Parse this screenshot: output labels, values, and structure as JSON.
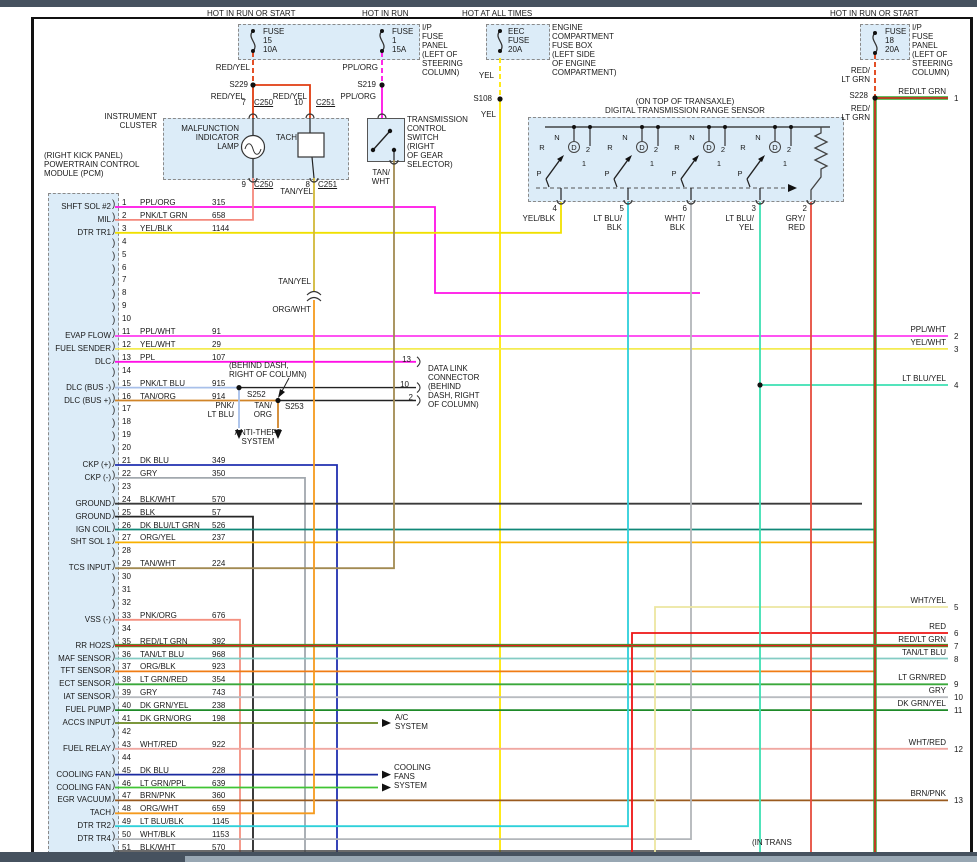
{
  "window": {
    "top_bar_color": "#46525f",
    "bottom_bar_color": "#46525f",
    "scroll_thumb_color": "#98a7b3",
    "page_bg": "#ffffff"
  },
  "labels": {
    "hot_left": "HOT IN RUN OR START",
    "hot_mid": "HOT IN RUN",
    "hot_eec": "HOT AT ALL TIMES",
    "hot_right": "HOT IN RUN OR START",
    "fuse15_1": "FUSE",
    "fuse15_2": "15",
    "fuse15_3": "10A",
    "fuse1_1": "FUSE",
    "fuse1_2": "1",
    "fuse1_3": "15A",
    "eec_1": "EEC",
    "eec_2": "FUSE",
    "eec_3": "20A",
    "fuse18_1": "FUSE",
    "fuse18_2": "18",
    "fuse18_3": "20A",
    "ip_note": [
      "I/P",
      "FUSE",
      "PANEL",
      "(LEFT OF",
      "STEERING",
      "COLUMN)"
    ],
    "eec_note": [
      "ENGINE",
      "COMPARTMENT",
      "FUSE BOX",
      "(LEFT SIDE",
      "OF ENGINE",
      "COMPARTMENT)"
    ],
    "ip_note_r": [
      "I/P",
      "FUSE",
      "PANEL",
      "(LEFT OF",
      "STEERING",
      "COLUMN)"
    ],
    "red_yel_a": "RED/YEL",
    "red_yel_b": "RED/YEL",
    "red_yel_c": "RED/YEL",
    "s229": "S229",
    "s219": "S219",
    "s108": "S108",
    "s228": "S228",
    "s252": "S252",
    "s253": "S253",
    "ppl_org_a": "PPL/ORG",
    "ppl_org_b": "PPL/ORG",
    "yel_a": "YEL",
    "yel_b": "YEL",
    "red_lt_a": [
      "RED/",
      "LT GRN"
    ],
    "red_lt_b": [
      "RED/",
      "LT GRN"
    ],
    "cluster_title": [
      "INSTRUMENT",
      "CLUSTER"
    ],
    "mil": [
      "MALFUNCTION",
      "INDICATOR",
      "LAMP"
    ],
    "tach": "TACH",
    "c250t_pin": "7",
    "c250t": "C250",
    "c251t_pin": "10",
    "c251t": "C251",
    "c250b_pin": "9",
    "c250b": "C250",
    "c251b_pin": "8",
    "c251b": "C251",
    "tan_yel_a": "TAN/YEL",
    "tan_yel_b": "TAN/YEL",
    "org_wht": "ORG/WHT",
    "tcs_note": [
      "TRANSMISSION",
      "CONTROL",
      "SWITCH",
      "(RIGHT",
      "OF GEAR",
      "SELECTOR)"
    ],
    "tan_wht": [
      "TAN/",
      "WHT"
    ],
    "dtr_loc": "(ON TOP OF TRANSAXLE)",
    "dtr_title": "DIGITAL TRANSMISSION RANGE SENSOR",
    "behind_dash": [
      "(BEHIND DASH,",
      "RIGHT OF COLUMN)"
    ],
    "dlc_note": [
      "DATA LINK",
      "CONNECTOR",
      "(BEHIND",
      "DASH, RIGHT",
      "OF COLUMN)"
    ],
    "dlc_13": "13",
    "dlc_10": "10",
    "dlc_2": "2",
    "pnk_ltblu": [
      "PNK/",
      "LT BLU"
    ],
    "tan_org": [
      "TAN/",
      "ORG"
    ],
    "anti_theft": [
      "ANTI-THEFT",
      "SYSTEM"
    ],
    "ac": [
      "A/C",
      "SYSTEM"
    ],
    "fans": [
      "COOLING",
      "FANS",
      "SYSTEM"
    ],
    "in_trans": "(IN TRANS",
    "pcm_header": [
      "(RIGHT KICK PANEL)",
      "POWERTRAIN CONTROL",
      "MODULE (PCM)"
    ]
  },
  "dtr": {
    "positions": [
      "R",
      "N",
      "D",
      "2",
      "1",
      "P"
    ],
    "terminals": [
      {
        "pin": "4",
        "wire": [
          "YEL/BLK"
        ]
      },
      {
        "pin": "5",
        "wire": [
          "LT BLU/",
          "BLK"
        ]
      },
      {
        "pin": "6",
        "wire": [
          "WHT/",
          "BLK"
        ]
      },
      {
        "pin": "3",
        "wire": [
          "LT BLU/",
          "YEL"
        ]
      },
      {
        "pin": "2",
        "wire": [
          "GRY/",
          "RED"
        ]
      }
    ]
  },
  "pcm": {
    "pins": [
      {
        "n": "1",
        "label": "SHFT SOL #2",
        "wire": "PPL/ORG",
        "circuit": "315"
      },
      {
        "n": "2",
        "label": "MIL",
        "wire": "PNK/LT GRN",
        "circuit": "658"
      },
      {
        "n": "3",
        "label": "DTR TR1",
        "wire": "YEL/BLK",
        "circuit": "1144"
      },
      {
        "n": "4",
        "label": "",
        "wire": "",
        "circuit": ""
      },
      {
        "n": "5",
        "label": "",
        "wire": "",
        "circuit": ""
      },
      {
        "n": "6",
        "label": "",
        "wire": "",
        "circuit": ""
      },
      {
        "n": "7",
        "label": "",
        "wire": "",
        "circuit": ""
      },
      {
        "n": "8",
        "label": "",
        "wire": "",
        "circuit": ""
      },
      {
        "n": "9",
        "label": "",
        "wire": "",
        "circuit": ""
      },
      {
        "n": "10",
        "label": "",
        "wire": "",
        "circuit": ""
      },
      {
        "n": "11",
        "label": "EVAP FLOW",
        "wire": "PPL/WHT",
        "circuit": "91"
      },
      {
        "n": "12",
        "label": "FUEL SENDER",
        "wire": "YEL/WHT",
        "circuit": "29"
      },
      {
        "n": "13",
        "label": "DLC",
        "wire": "PPL",
        "circuit": "107"
      },
      {
        "n": "14",
        "label": "",
        "wire": "",
        "circuit": ""
      },
      {
        "n": "15",
        "label": "DLC (BUS -)",
        "wire": "PNK/LT BLU",
        "circuit": "915"
      },
      {
        "n": "16",
        "label": "DLC (BUS +)",
        "wire": "TAN/ORG",
        "circuit": "914"
      },
      {
        "n": "17",
        "label": "",
        "wire": "",
        "circuit": ""
      },
      {
        "n": "18",
        "label": "",
        "wire": "",
        "circuit": ""
      },
      {
        "n": "19",
        "label": "",
        "wire": "",
        "circuit": ""
      },
      {
        "n": "20",
        "label": "",
        "wire": "",
        "circuit": ""
      },
      {
        "n": "21",
        "label": "CKP (+)",
        "wire": "DK BLU",
        "circuit": "349"
      },
      {
        "n": "22",
        "label": "CKP (-)",
        "wire": "GRY",
        "circuit": "350"
      },
      {
        "n": "23",
        "label": "",
        "wire": "",
        "circuit": ""
      },
      {
        "n": "24",
        "label": "GROUND",
        "wire": "BLK/WHT",
        "circuit": "570"
      },
      {
        "n": "25",
        "label": "GROUND",
        "wire": "BLK",
        "circuit": "57"
      },
      {
        "n": "26",
        "label": "IGN COIL",
        "wire": "DK BLU/LT GRN",
        "circuit": "526"
      },
      {
        "n": "27",
        "label": "SHT SOL 1",
        "wire": "ORG/YEL",
        "circuit": "237"
      },
      {
        "n": "28",
        "label": "",
        "wire": "",
        "circuit": ""
      },
      {
        "n": "29",
        "label": "TCS INPUT",
        "wire": "TAN/WHT",
        "circuit": "224"
      },
      {
        "n": "30",
        "label": "",
        "wire": "",
        "circuit": ""
      },
      {
        "n": "31",
        "label": "",
        "wire": "",
        "circuit": ""
      },
      {
        "n": "32",
        "label": "",
        "wire": "",
        "circuit": ""
      },
      {
        "n": "33",
        "label": "VSS (-)",
        "wire": "PNK/ORG",
        "circuit": "676"
      },
      {
        "n": "34",
        "label": "",
        "wire": "",
        "circuit": ""
      },
      {
        "n": "35",
        "label": "RR HO2S",
        "wire": "RED/LT GRN",
        "circuit": "392"
      },
      {
        "n": "36",
        "label": "MAF SENSOR",
        "wire": "TAN/LT BLU",
        "circuit": "968"
      },
      {
        "n": "37",
        "label": "TFT SENSOR",
        "wire": "ORG/BLK",
        "circuit": "923"
      },
      {
        "n": "38",
        "label": "ECT SENSOR",
        "wire": "LT GRN/RED",
        "circuit": "354"
      },
      {
        "n": "39",
        "label": "IAT SENSOR",
        "wire": "GRY",
        "circuit": "743"
      },
      {
        "n": "40",
        "label": "FUEL PUMP",
        "wire": "DK GRN/YEL",
        "circuit": "238"
      },
      {
        "n": "41",
        "label": "ACCS INPUT",
        "wire": "DK GRN/ORG",
        "circuit": "198"
      },
      {
        "n": "42",
        "label": "",
        "wire": "",
        "circuit": ""
      },
      {
        "n": "43",
        "label": "FUEL RELAY",
        "wire": "WHT/RED",
        "circuit": "922"
      },
      {
        "n": "44",
        "label": "",
        "wire": "",
        "circuit": ""
      },
      {
        "n": "45",
        "label": "COOLING FAN",
        "wire": "DK BLU",
        "circuit": "228"
      },
      {
        "n": "46",
        "label": "COOLING FAN",
        "wire": "LT GRN/PPL",
        "circuit": "639"
      },
      {
        "n": "47",
        "label": "EGR VACUUM",
        "wire": "BRN/PNK",
        "circuit": "360"
      },
      {
        "n": "48",
        "label": "TACH",
        "wire": "ORG/WHT",
        "circuit": "659"
      },
      {
        "n": "49",
        "label": "DTR TR2",
        "wire": "LT BLU/BLK",
        "circuit": "1145"
      },
      {
        "n": "50",
        "label": "DTR TR4",
        "wire": "WHT/BLK",
        "circuit": "1153"
      },
      {
        "n": "51",
        "label": "",
        "wire": "BLK/WHT",
        "circuit": "570"
      }
    ]
  },
  "right_edge": [
    {
      "n": "1",
      "wire": "RED/LT GRN"
    },
    {
      "n": "2",
      "wire": "PPL/WHT"
    },
    {
      "n": "3",
      "wire": "YEL/WHT"
    },
    {
      "n": "4",
      "wire": "LT BLU/YEL"
    },
    {
      "n": "5",
      "wire": "WHT/YEL"
    },
    {
      "n": "6",
      "wire": "RED"
    },
    {
      "n": "7",
      "wire": "RED/LT GRN"
    },
    {
      "n": "8",
      "wire": "TAN/LT BLU"
    },
    {
      "n": "9",
      "wire": "LT GRN/RED"
    },
    {
      "n": "10",
      "wire": "GRY"
    },
    {
      "n": "11",
      "wire": "DK GRN/YEL"
    },
    {
      "n": "12",
      "wire": "WHT/RED"
    },
    {
      "n": "13",
      "wire": "BRN/PNK"
    }
  ],
  "colors": {
    "RED/YEL": "#e03c10",
    "PPL/ORG": "#ff10e6",
    "YEL": "#ffe800",
    "RED/LT GRN": "#e02020",
    "GREEN_PAIR": "#2eaa2e",
    "PNK/LT GRN": "#f4887c",
    "YEL/BLK": "#f0e000",
    "PPL/WHT": "#ff3cf0",
    "YEL/WHT": "#f4ec52",
    "PPL": "#ff10e6",
    "PNK/LT BLU": "#a8c0ea",
    "TAN/ORG": "#d08428",
    "BLK_LEAD": "#222222",
    "DK BLU": "#2030b0",
    "GRY": "#a2a8ae",
    "BLK/WHT": "#3a3a3a",
    "BLK": "#262626",
    "DK BLU/LT GRN": "#108878",
    "ORG/YEL": "#f8b000",
    "TAN/WHT": "#a28a52",
    "PNK/ORG": "#f49080",
    "TAN/LT BLU": "#84ccc4",
    "ORG/BLK": "#f07c14",
    "LT GRN/RED": "#3aa83a",
    "GRY2": "#b8bcc0",
    "DK GRN/YEL": "#1e8a28",
    "DK GRN/ORG": "#6a8820",
    "WHT/RED": "#f0a8a2",
    "DK BLU2": "#1a2aa0",
    "LT GRN/PPL": "#40c434",
    "BRN/PNK": "#9a5a1e",
    "ORG/WHT": "#f59a1e",
    "TAN/YEL": "#d2b838",
    "LT BLU/BLK": "#2ed0da",
    "WHT/BLK": "#b2b6ba",
    "WHT/YEL": "#ece6a0",
    "RED": "#ee1414",
    "LT BLU/YEL": "#3ce0b2",
    "GRY/RED": "#e64c3c",
    "box_fill": "#dcecf8",
    "frame": "#111111",
    "symbol": "#333333"
  }
}
